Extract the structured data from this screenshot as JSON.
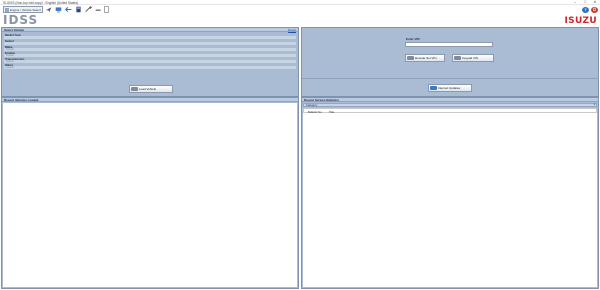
{
  "window": {
    "title": "IS-IDSS (Non-top fold-copy) - English (United States)",
    "minimize": "–",
    "maximize": "□",
    "close": "✕"
  },
  "toolbar": {
    "home_label": "Engine / Vehicle Select",
    "icons": [
      "plane-icon",
      "screen-icon",
      "connect-icon",
      "calculator-icon",
      "tools-icon",
      "document-icon"
    ],
    "help": "?",
    "exit": "⏻"
  },
  "branding": {
    "logo": "IDSS",
    "tagline": "ISUZU DIAGNOSTIC SERVICE SYSTEM",
    "brand": "ISUZU"
  },
  "select_vehicle": {
    "header": "Select Vehicle",
    "reset": "Reset",
    "fields": [
      {
        "label": "Model Year",
        "value": ""
      },
      {
        "label": "Select",
        "value": ""
      },
      {
        "label": "Make",
        "value": "Default"
      },
      {
        "label": "Engine",
        "value": "Default"
      },
      {
        "label": "Transmission",
        "value": "Default"
      },
      {
        "label": "Other",
        "value": "Default"
      }
    ],
    "load_button": "Load Vehicle"
  },
  "vin": {
    "label": "Enter VIN",
    "value": "",
    "decode_button": "Decode Set VIN",
    "keypad_button": "Keypad VIN",
    "internet_button": "Internet Updates"
  },
  "recent_vehicles": {
    "header": "Recent Vehicles Loaded"
  },
  "bulletins": {
    "header": "Recent Service Bulletins",
    "dropdown": "Category",
    "columns": [
      "Bulletin No.",
      "Title"
    ]
  },
  "colors": {
    "panel": "#a9bcd3",
    "panel_header": "#b9cbe0",
    "brand_red": "#d2232a"
  }
}
